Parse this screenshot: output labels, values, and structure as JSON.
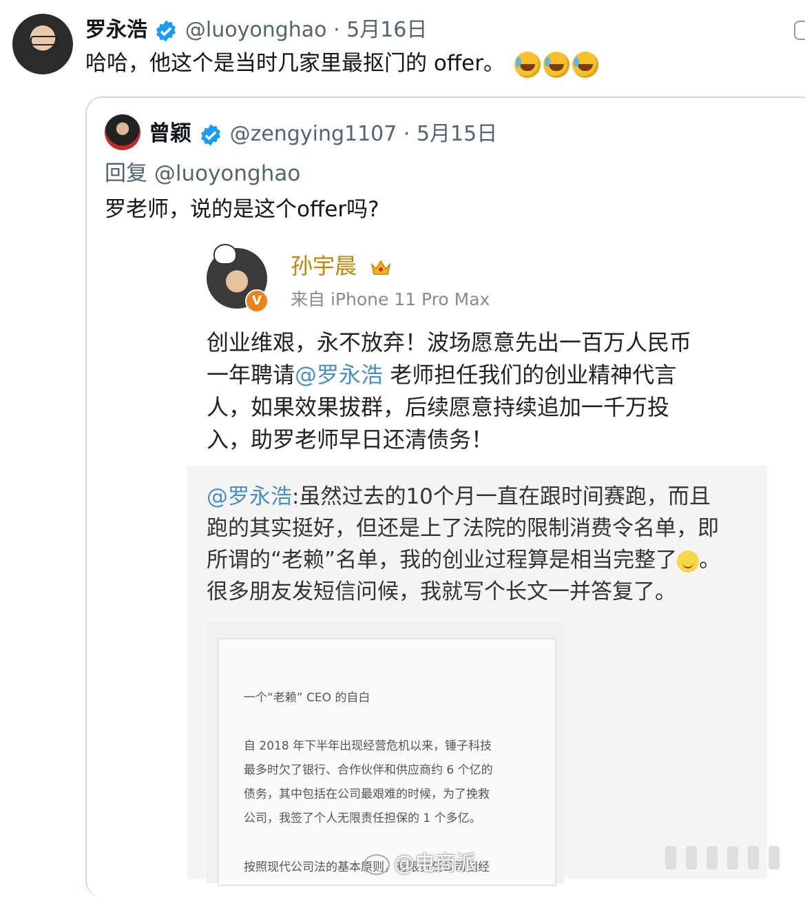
{
  "main_tweet": {
    "name": "罗永浩",
    "handle_date": "@luoyonghao · 5月16日",
    "text": "哈哈，他这个是当时几家里最抠门的 offer。"
  },
  "quoted_tweet": {
    "name": "曾颖",
    "handle_date": "@zengying1107 · 5月15日",
    "reply_to": "回复 @luoyonghao",
    "text": "罗老师，说的是这个offer吗?"
  },
  "weibo_post": {
    "name": "孙宇晨",
    "source": "来自 iPhone 11 Pro Max",
    "badge": "V",
    "body_lines": [
      "创业维艰，永不放弃！波场愿意先出一百万人民币",
      "老师担任我们的创业精神代言",
      "人，如果效果拔群，后续愿意持续追加一千万投",
      "入，助罗老师早日还清债务！"
    ],
    "body_line2_prefix": "一年聘请",
    "body_mention": "@罗永浩"
  },
  "repost": {
    "mention": "@罗永浩",
    "line1_rest": ":虽然过去的10个月一直在跟时间赛跑，而且",
    "line2": "跑的其实挺好，但还是上了法院的限制消费令名单，即",
    "line3_before": "所谓的“老赖”名单，我的创业过程算是相当完整了",
    "line3_after": "。",
    "line4": "很多朋友发短信问候，我就写个长文一并答复了。"
  },
  "document": {
    "title": "一个“老赖” CEO 的自白",
    "para_lines": [
      "自 2018 年下半年出现经营危机以来，锤子科技",
      "最多时欠了银行、合作伙伴和供应商约 6 个亿的",
      "债务，其中包括在公司最艰难的时候，为了挽救",
      "公司，我签了个人无限责任担保的 1 个多亿。"
    ],
    "last_line": "按照现代公司法的基本原则，有限责任公司因经"
  },
  "watermark": "@电商派",
  "colors": {
    "verified_blue": "#1d9bf0",
    "mention_blue": "#4a8fbf",
    "weibo_name_gold": "#b8860b",
    "handle_gray": "#536471"
  }
}
